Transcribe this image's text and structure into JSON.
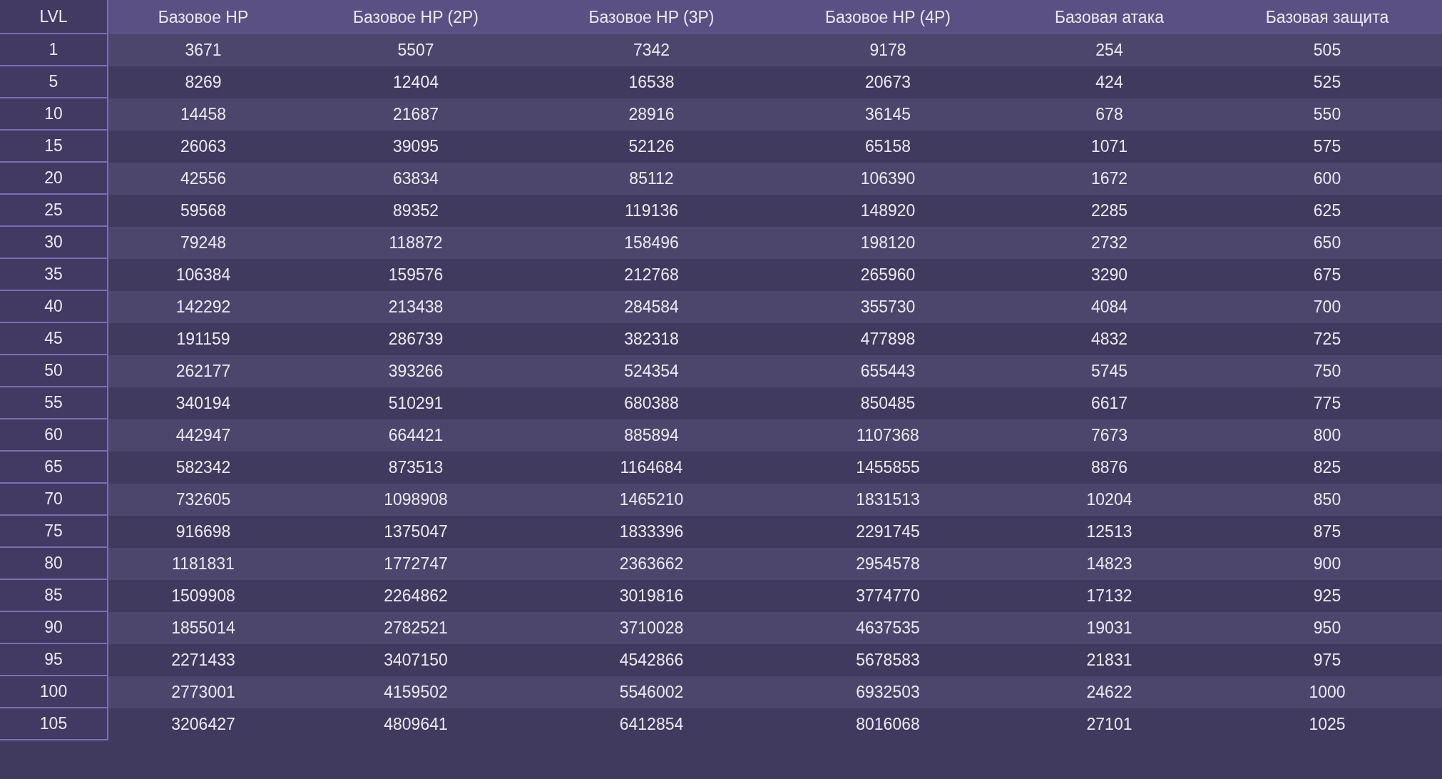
{
  "table": {
    "columns": [
      "LVL",
      "Базовое HP",
      "Базовое HP (2P)",
      "Базовое HP (3P)",
      "Базовое HP (4P)",
      "Базовая атака",
      "Базовая защита"
    ],
    "rows": [
      [
        "1",
        "3671",
        "5507",
        "7342",
        "9178",
        "254",
        "505"
      ],
      [
        "5",
        "8269",
        "12404",
        "16538",
        "20673",
        "424",
        "525"
      ],
      [
        "10",
        "14458",
        "21687",
        "28916",
        "36145",
        "678",
        "550"
      ],
      [
        "15",
        "26063",
        "39095",
        "52126",
        "65158",
        "1071",
        "575"
      ],
      [
        "20",
        "42556",
        "63834",
        "85112",
        "106390",
        "1672",
        "600"
      ],
      [
        "25",
        "59568",
        "89352",
        "119136",
        "148920",
        "2285",
        "625"
      ],
      [
        "30",
        "79248",
        "118872",
        "158496",
        "198120",
        "2732",
        "650"
      ],
      [
        "35",
        "106384",
        "159576",
        "212768",
        "265960",
        "3290",
        "675"
      ],
      [
        "40",
        "142292",
        "213438",
        "284584",
        "355730",
        "4084",
        "700"
      ],
      [
        "45",
        "191159",
        "286739",
        "382318",
        "477898",
        "4832",
        "725"
      ],
      [
        "50",
        "262177",
        "393266",
        "524354",
        "655443",
        "5745",
        "750"
      ],
      [
        "55",
        "340194",
        "510291",
        "680388",
        "850485",
        "6617",
        "775"
      ],
      [
        "60",
        "442947",
        "664421",
        "885894",
        "1107368",
        "7673",
        "800"
      ],
      [
        "65",
        "582342",
        "873513",
        "1164684",
        "1455855",
        "8876",
        "825"
      ],
      [
        "70",
        "732605",
        "1098908",
        "1465210",
        "1831513",
        "10204",
        "850"
      ],
      [
        "75",
        "916698",
        "1375047",
        "1833396",
        "2291745",
        "12513",
        "875"
      ],
      [
        "80",
        "1181831",
        "1772747",
        "2363662",
        "2954578",
        "14823",
        "900"
      ],
      [
        "85",
        "1509908",
        "2264862",
        "3019816",
        "3774770",
        "17132",
        "925"
      ],
      [
        "90",
        "1855014",
        "2782521",
        "3710028",
        "4637535",
        "19031",
        "950"
      ],
      [
        "95",
        "2271433",
        "3407150",
        "4542866",
        "5678583",
        "21831",
        "975"
      ],
      [
        "100",
        "2773001",
        "4159502",
        "5546002",
        "6932503",
        "24622",
        "1000"
      ],
      [
        "105",
        "3206427",
        "4809641",
        "6412854",
        "8016068",
        "27101",
        "1025"
      ]
    ]
  }
}
